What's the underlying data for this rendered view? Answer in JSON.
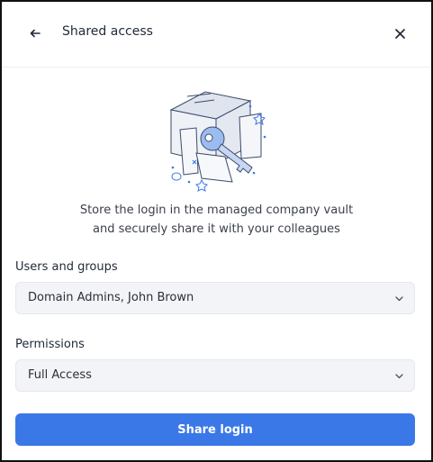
{
  "header": {
    "title": "Shared access",
    "back_icon": "arrow-left-icon",
    "close_icon": "close-icon"
  },
  "illustration": {
    "icon": "vault-key-illustration"
  },
  "description": {
    "line1": "Store the login in the managed company vault",
    "line2": "and securely share it with your colleagues"
  },
  "users_field": {
    "label": "Users and groups",
    "value": "Domain Admins, John Brown"
  },
  "permissions_field": {
    "label": "Permissions",
    "value": "Full Access"
  },
  "actions": {
    "share_label": "Share login"
  },
  "colors": {
    "primary": "#3b78e7",
    "accent_illustration": "#9bbcf0",
    "field_bg": "#f3f4f7"
  }
}
